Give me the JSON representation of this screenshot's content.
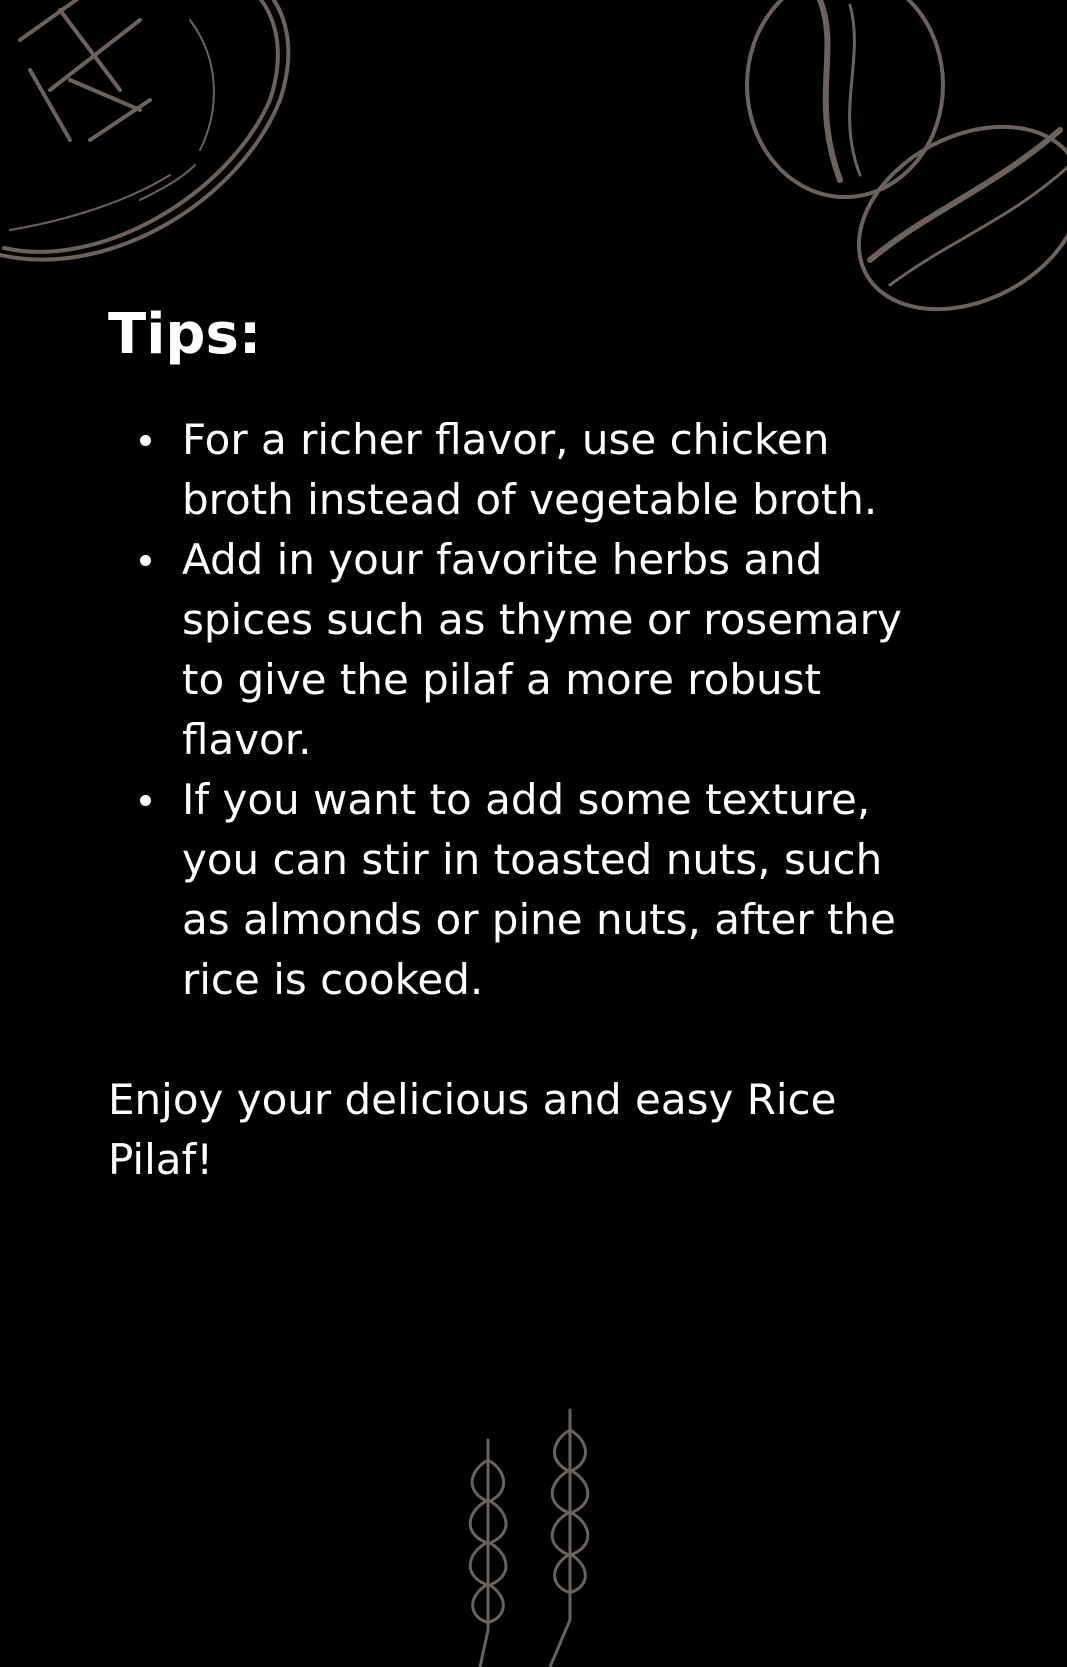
{
  "colors": {
    "background": "#000000",
    "text": "#ffffff",
    "illustration": "#6b615d"
  },
  "decorations": [
    "bread-loaf-icon",
    "coffee-beans-icon",
    "wheat-icon"
  ],
  "tips": {
    "title": "Tips:",
    "items": [
      "For a richer flavor, use chicken broth instead of vegetable broth.",
      "Add in your favorite herbs and spices such as thyme or rosemary to give the pilaf a more robust flavor.",
      "If you want to add some texture, you can stir in toasted nuts, such as almonds or pine nuts, after the rice is cooked."
    ]
  },
  "closing": "Enjoy your delicious and easy Rice Pilaf!"
}
